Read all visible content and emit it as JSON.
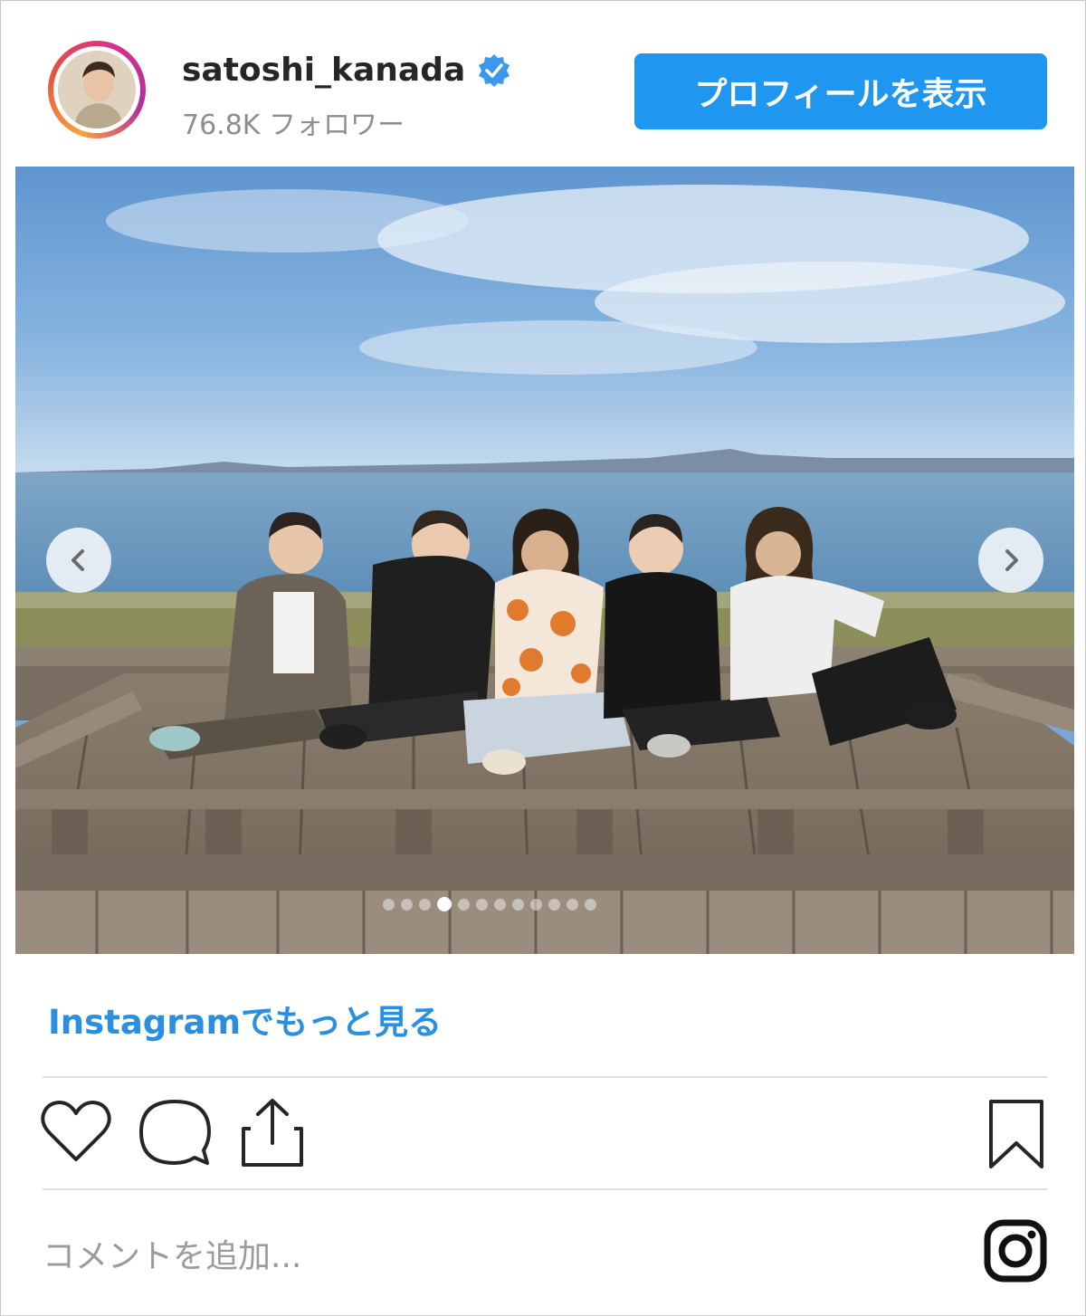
{
  "header": {
    "username": "satoshi_kanada",
    "followers": "76.8K フォロワー",
    "profile_button": "プロフィールを表示"
  },
  "post": {
    "carousel": {
      "total_slides": 12,
      "active_slide": 3
    }
  },
  "more_link": "Instagramでもっと見る",
  "actions": {
    "icons": [
      "heart-icon",
      "comment-bubble-icon",
      "share-icon",
      "bookmark-icon"
    ]
  },
  "comment_input": {
    "placeholder": "コメントを追加..."
  },
  "footer_icon": "instagram-logo-icon",
  "colors": {
    "button_blue": "#1f97f0",
    "link_blue": "#2a8fe0",
    "verified_blue": "#3b97f0",
    "text_dark": "#262626",
    "text_muted": "#8e8e8e"
  }
}
